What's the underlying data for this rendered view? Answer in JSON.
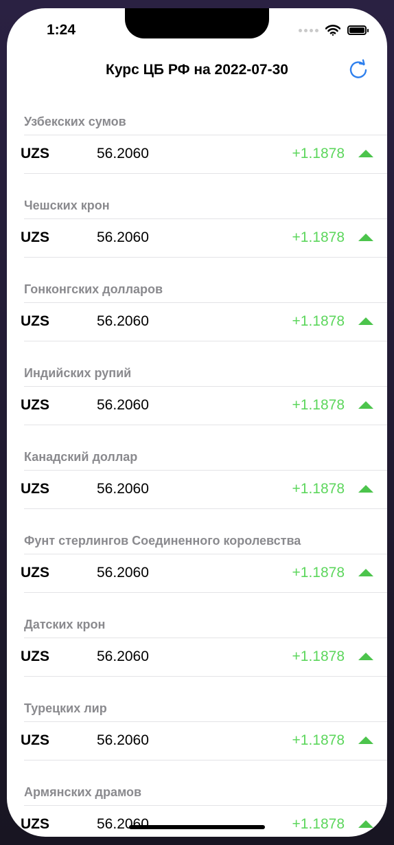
{
  "status_bar": {
    "time": "1:24"
  },
  "nav": {
    "title": "Курс ЦБ РФ на 2022-07-30"
  },
  "colors": {
    "accent": "#2f80ed",
    "positive": "#5cd65c",
    "header_text": "#8a8a8e"
  },
  "sections": [
    {
      "header": "Узбекских сумов",
      "code": "UZS",
      "rate": "56.2060",
      "change": "+1.1878",
      "trend": "up"
    },
    {
      "header": "Чешских крон",
      "code": "UZS",
      "rate": "56.2060",
      "change": "+1.1878",
      "trend": "up"
    },
    {
      "header": "Гонконгских долларов",
      "code": "UZS",
      "rate": "56.2060",
      "change": "+1.1878",
      "trend": "up"
    },
    {
      "header": "Индийских рупий",
      "code": "UZS",
      "rate": "56.2060",
      "change": "+1.1878",
      "trend": "up"
    },
    {
      "header": "Канадский доллар",
      "code": "UZS",
      "rate": "56.2060",
      "change": "+1.1878",
      "trend": "up"
    },
    {
      "header": "Фунт стерлингов Соединенного королевства",
      "code": "UZS",
      "rate": "56.2060",
      "change": "+1.1878",
      "trend": "up"
    },
    {
      "header": "Датских крон",
      "code": "UZS",
      "rate": "56.2060",
      "change": "+1.1878",
      "trend": "up"
    },
    {
      "header": "Турецких лир",
      "code": "UZS",
      "rate": "56.2060",
      "change": "+1.1878",
      "trend": "up"
    },
    {
      "header": "Армянских драмов",
      "code": "UZS",
      "rate": "56.2060",
      "change": "+1.1878",
      "trend": "up"
    }
  ]
}
